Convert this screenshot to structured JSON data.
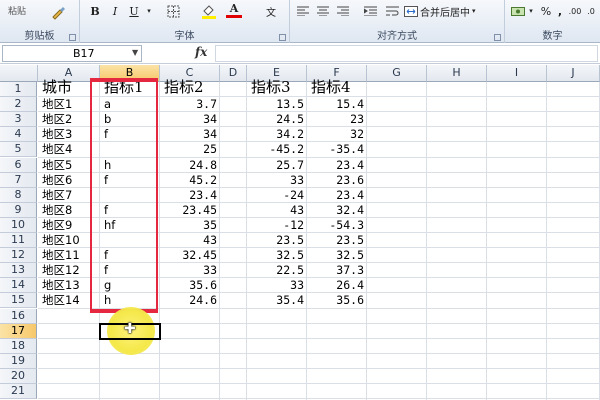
{
  "ribbon": {
    "clipboard": {
      "label": "剪贴板",
      "paste_label": "粘贴"
    },
    "font": {
      "label": "字体",
      "bold": "B",
      "italic": "I",
      "underline": "U",
      "font_color_letter": "A",
      "phonetic": "文"
    },
    "alignment": {
      "label": "对齐方式",
      "merge_label": "合并后居中"
    },
    "number": {
      "label": "数字",
      "percent": "%",
      "comma": ",",
      "inc_decimal": ".00",
      "dec_decimal": ".0"
    }
  },
  "formula_bar": {
    "name_box": "B17",
    "fx": "fx",
    "formula": ""
  },
  "columns": [
    "A",
    "B",
    "C",
    "D",
    "E",
    "F",
    "G",
    "H",
    "I",
    "J"
  ],
  "rows": [
    "1",
    "2",
    "3",
    "4",
    "5",
    "6",
    "7",
    "8",
    "9",
    "10",
    "11",
    "12",
    "13",
    "14",
    "15",
    "16",
    "17",
    "18",
    "19",
    "20",
    "21"
  ],
  "headers": {
    "a": "城市",
    "b": "指标1",
    "c": "指标2",
    "e": "指标3",
    "f": "指标4"
  },
  "data": [
    {
      "a": "地区1",
      "b": "a",
      "c": "3.7",
      "e": "13.5",
      "f": "15.4"
    },
    {
      "a": "地区2",
      "b": "b",
      "c": "34",
      "e": "24.5",
      "f": "23"
    },
    {
      "a": "地区3",
      "b": "f",
      "c": "34",
      "e": "34.2",
      "f": "32"
    },
    {
      "a": "地区4",
      "b": "",
      "c": "25",
      "e": "-45.2",
      "f": "-35.4"
    },
    {
      "a": "地区5",
      "b": "h",
      "c": "24.8",
      "e": "25.7",
      "f": "23.4"
    },
    {
      "a": "地区6",
      "b": "f",
      "c": "45.2",
      "e": "33",
      "f": "23.6"
    },
    {
      "a": "地区7",
      "b": "",
      "c": "23.4",
      "e": "-24",
      "f": "23.4"
    },
    {
      "a": "地区8",
      "b": "f",
      "c": "23.45",
      "e": "43",
      "f": "32.4"
    },
    {
      "a": "地区9",
      "b": "hf",
      "c": "35",
      "e": "-12",
      "f": "-54.3"
    },
    {
      "a": "地区10",
      "b": "",
      "c": "43",
      "e": "23.5",
      "f": "23.5"
    },
    {
      "a": "地区11",
      "b": "f",
      "c": "32.45",
      "e": "32.5",
      "f": "32.5"
    },
    {
      "a": "地区12",
      "b": "f",
      "c": "33",
      "e": "22.5",
      "f": "37.3"
    },
    {
      "a": "地区13",
      "b": "g",
      "c": "35.6",
      "e": "33",
      "f": "26.4"
    },
    {
      "a": "地区14",
      "b": "h",
      "c": "24.6",
      "e": "35.4",
      "f": "35.6"
    }
  ],
  "selection": {
    "active_cell": "B17",
    "active_column": "B",
    "active_row": "17"
  },
  "colors": {
    "annotation_red": "#e5283f",
    "cursor_highlight": "#f4e84a"
  },
  "icons": [
    "paste-icon",
    "format-painter-icon",
    "border-icon",
    "fill-color-icon",
    "font-color-icon",
    "align-icon",
    "wrap-icon",
    "merge-icon",
    "currency-icon",
    "fx-icon",
    "cursor-cross-icon"
  ]
}
